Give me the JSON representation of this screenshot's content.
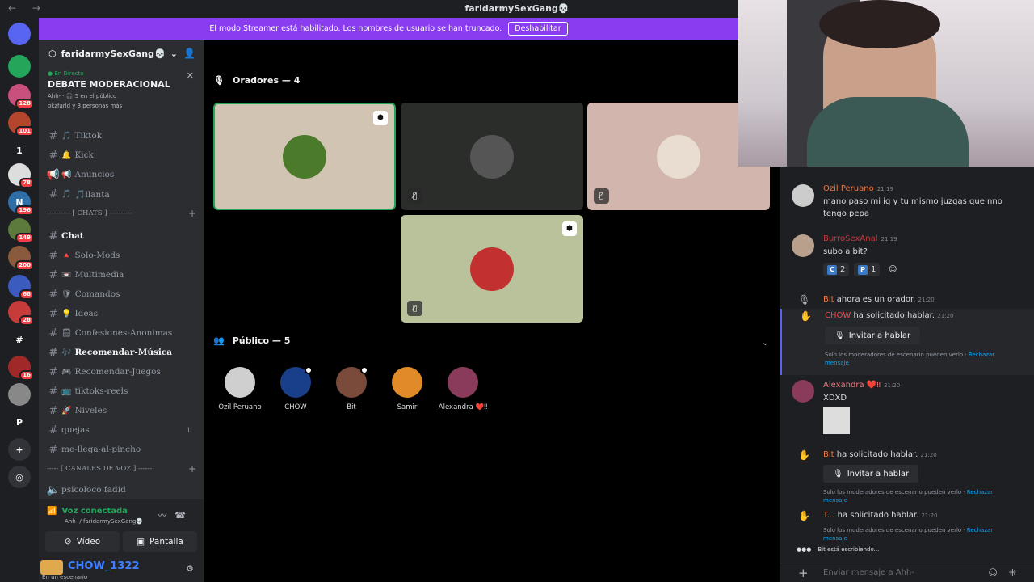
{
  "window": {
    "title": "faridarmySexGang💀",
    "nav": "← →"
  },
  "banner": {
    "text": "El modo Streamer está habilitado. Los nombres de usuario se han truncado.",
    "button": "Deshabilitar"
  },
  "rail": {
    "servers": [
      {
        "label": "",
        "color": "#5865f2",
        "badge": ""
      },
      {
        "label": "",
        "color": "#23a55a",
        "badge": ""
      },
      {
        "label": "",
        "color": "#c94f7c",
        "badge": "128"
      },
      {
        "label": "",
        "color": "#b5462e",
        "badge": "101"
      },
      {
        "label": "1",
        "color": "#1e1f22",
        "badge": ""
      },
      {
        "label": "",
        "color": "#ddd",
        "badge": "78"
      },
      {
        "label": "N",
        "color": "#2f6fa8",
        "badge": "196"
      },
      {
        "label": "",
        "color": "#5c7a3c",
        "badge": "149"
      },
      {
        "label": "",
        "color": "#8a5a3c",
        "badge": "200"
      },
      {
        "label": "",
        "color": "#3b5bbf",
        "badge": "68"
      },
      {
        "label": "",
        "color": "#c73b3b",
        "badge": "28"
      },
      {
        "label": "#",
        "color": "#1e1f22",
        "badge": ""
      },
      {
        "label": "",
        "color": "#a02828",
        "badge": "16"
      },
      {
        "label": "",
        "color": "#888",
        "badge": ""
      },
      {
        "label": "P",
        "color": "#1e1f22",
        "badge": ""
      },
      {
        "label": "+",
        "color": "#313338",
        "badge": ""
      },
      {
        "label": "◎",
        "color": "#313338",
        "badge": ""
      }
    ]
  },
  "sidebar": {
    "guild_name": "faridarmySexGang💀",
    "live": {
      "tag": "En Directo",
      "title": "DEBATE MODERACIONAL",
      "meta": "Ahh- · 🎧 5 en el público",
      "people": "okzfarld y 3 personas más"
    },
    "channels_top": [
      {
        "name": "Tiktok",
        "emoji": "🎵",
        "icon": "#"
      },
      {
        "name": "Kick",
        "emoji": "🔔",
        "icon": "#"
      },
      {
        "name": "Anuncios",
        "emoji": "📢",
        "icon": "📢"
      },
      {
        "name": "🎵llanta",
        "emoji": "🎵",
        "icon": "#"
      }
    ],
    "cat_chats": "---------- [ CHATS ] ----------",
    "channels_chats": [
      {
        "name": "Chat",
        "emoji": "",
        "unread": true
      },
      {
        "name": "Solo-Mods",
        "emoji": "🔺",
        "unread": false
      },
      {
        "name": "Multimedia",
        "emoji": "📼",
        "unread": false
      },
      {
        "name": "Comandos",
        "emoji": "🛡",
        "unread": false
      },
      {
        "name": "Ideas",
        "emoji": "💡",
        "unread": false
      },
      {
        "name": "Confesiones-Anonimas",
        "emoji": "🗒",
        "unread": false
      },
      {
        "name": "Recomendar-Música",
        "emoji": "🎶",
        "unread": true
      },
      {
        "name": "Recomendar-Juegos",
        "emoji": "🎮",
        "unread": false
      },
      {
        "name": "tiktoks-reels",
        "emoji": "📺",
        "unread": false
      },
      {
        "name": "Niveles",
        "emoji": "🚀",
        "unread": false
      },
      {
        "name": "quejas",
        "emoji": "",
        "unread": false,
        "count": "1"
      },
      {
        "name": "me-llega-al-pincho",
        "emoji": "",
        "unread": false
      }
    ],
    "cat_voice": "----- [ CANALES DE VOZ ] ------",
    "voice_channel": "psicoloco fadid",
    "voice": {
      "status": "Voz conectada",
      "location": "Ahh- / faridarmySexGang💀",
      "video_label": "Vídeo",
      "screen_label": "Pantalla",
      "user_name": "CHOW_1322",
      "user_status": "En un escenario"
    }
  },
  "stage": {
    "speakers_label": "Oradores — 4",
    "audience_label": "Público — 5",
    "speakers": [
      {
        "bg": "#d1c4b3",
        "av": "#4a7a2a",
        "active": true,
        "badge": true,
        "muted": false
      },
      {
        "bg": "#2b2d2b",
        "av": "#555",
        "active": false,
        "badge": false,
        "muted": true
      },
      {
        "bg": "#d2b6ae",
        "av": "#e8ddd0",
        "active": false,
        "badge": false,
        "muted": true
      },
      {
        "bg": "#b9c29a",
        "av": "#c23030",
        "active": false,
        "badge": true,
        "muted": true
      }
    ],
    "audience": [
      {
        "name": "Ozil Peruano",
        "av": "#cfcfcf",
        "dot": false
      },
      {
        "name": "CHOW",
        "av": "#1a3f8a",
        "dot": true
      },
      {
        "name": "Bit",
        "av": "#7a4a3a",
        "dot": true
      },
      {
        "name": "Samir",
        "av": "#e08a2a",
        "dot": false
      },
      {
        "name": "Alexandra ❤️‼",
        "av": "#8a3a5a",
        "dot": false
      }
    ]
  },
  "chat": {
    "messages": [
      {
        "author": "Ozil Peruano",
        "color": "#f0763e",
        "time": "21:19",
        "text": "mano paso mi ig y tu mismo juzgas que nno tengo pepa"
      },
      {
        "author": "BurroSexAnal",
        "color": "#c23b3b",
        "time": "21:19",
        "text": "subo a bit?"
      }
    ],
    "reactions": [
      {
        "chip": "C",
        "count": "2"
      },
      {
        "chip": "P",
        "count": "1"
      }
    ],
    "sys1": {
      "name": "Bit",
      "text": "ahora es un orador.",
      "time": "21:20"
    },
    "req1": {
      "name": "CHOW",
      "text": "ha solicitado hablar.",
      "time": "21:20"
    },
    "invite_label": "Invitar a hablar",
    "note_text": "Solo los moderadores de escenario pueden verlo · ",
    "note_link": "Rechazar mensaje",
    "alex": {
      "author": "Alexandra ❤️‼",
      "color": "#f0767e",
      "time": "21:20",
      "text": "XDXD"
    },
    "req2": {
      "name": "Bit",
      "text": "ha solicitado hablar.",
      "time": "21:20"
    },
    "req3": {
      "name": "T...",
      "text": "ha solicitado hablar.",
      "time": "21:20"
    },
    "typing": "Bit está escribiendo...",
    "composer_placeholder": "Enviar mensaje a Ahh-"
  }
}
